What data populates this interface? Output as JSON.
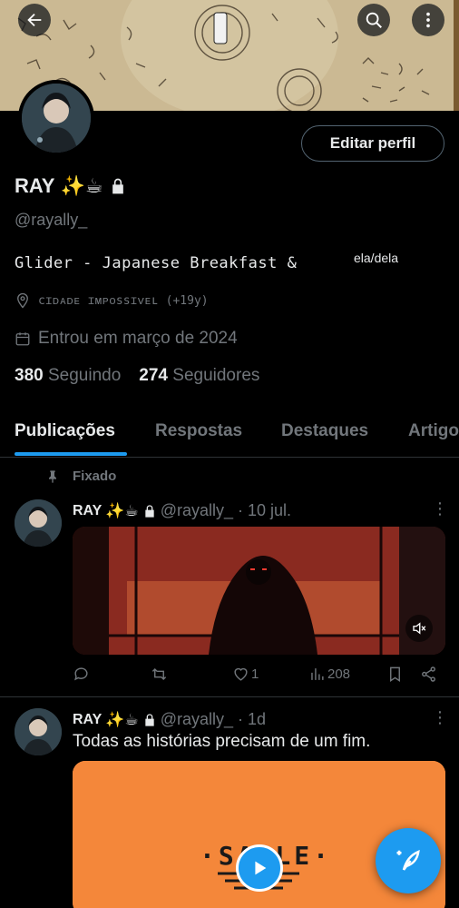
{
  "header": {
    "back_icon": "arrow-left-icon",
    "search_icon": "search-icon",
    "more_icon": "more-vertical-icon"
  },
  "profile": {
    "name": "RAY",
    "emojis": "✨☕",
    "handle": "@rayally_",
    "edit_button": "Editar perfil",
    "bio": "Glider - Japanese Breakfast &",
    "pronouns": "ela/dela",
    "location": "cɪᴅᴀᴅᴇ ɪᴍᴘᴏssɪᴠᴇʟ   (+19y)",
    "joined": "Entrou em março de 2024",
    "following_count": "380",
    "following_label": "Seguindo",
    "followers_count": "274",
    "followers_label": "Seguidores"
  },
  "tabs": [
    {
      "label": "Publicações",
      "active": true
    },
    {
      "label": "Respostas",
      "active": false
    },
    {
      "label": "Destaques",
      "active": false
    },
    {
      "label": "Artigos",
      "active": false
    }
  ],
  "posts": [
    {
      "pinned_label": "Fixado",
      "name": "RAY",
      "emojis": "✨☕",
      "handle_time": "@rayally_ · 10 jul.",
      "stats": {
        "replies": "",
        "reposts": "",
        "likes": "1",
        "views": "208"
      }
    },
    {
      "name": "RAY",
      "emojis": "✨☕",
      "handle_time": "@rayally_ · 1d",
      "text": "Todas as histórias precisam de um fim.",
      "media_text": "·SABLE·"
    }
  ],
  "colors": {
    "accent": "#1d9bf0",
    "text_primary": "#e7e9ea",
    "text_secondary": "#71767b",
    "border": "#2f3336"
  }
}
